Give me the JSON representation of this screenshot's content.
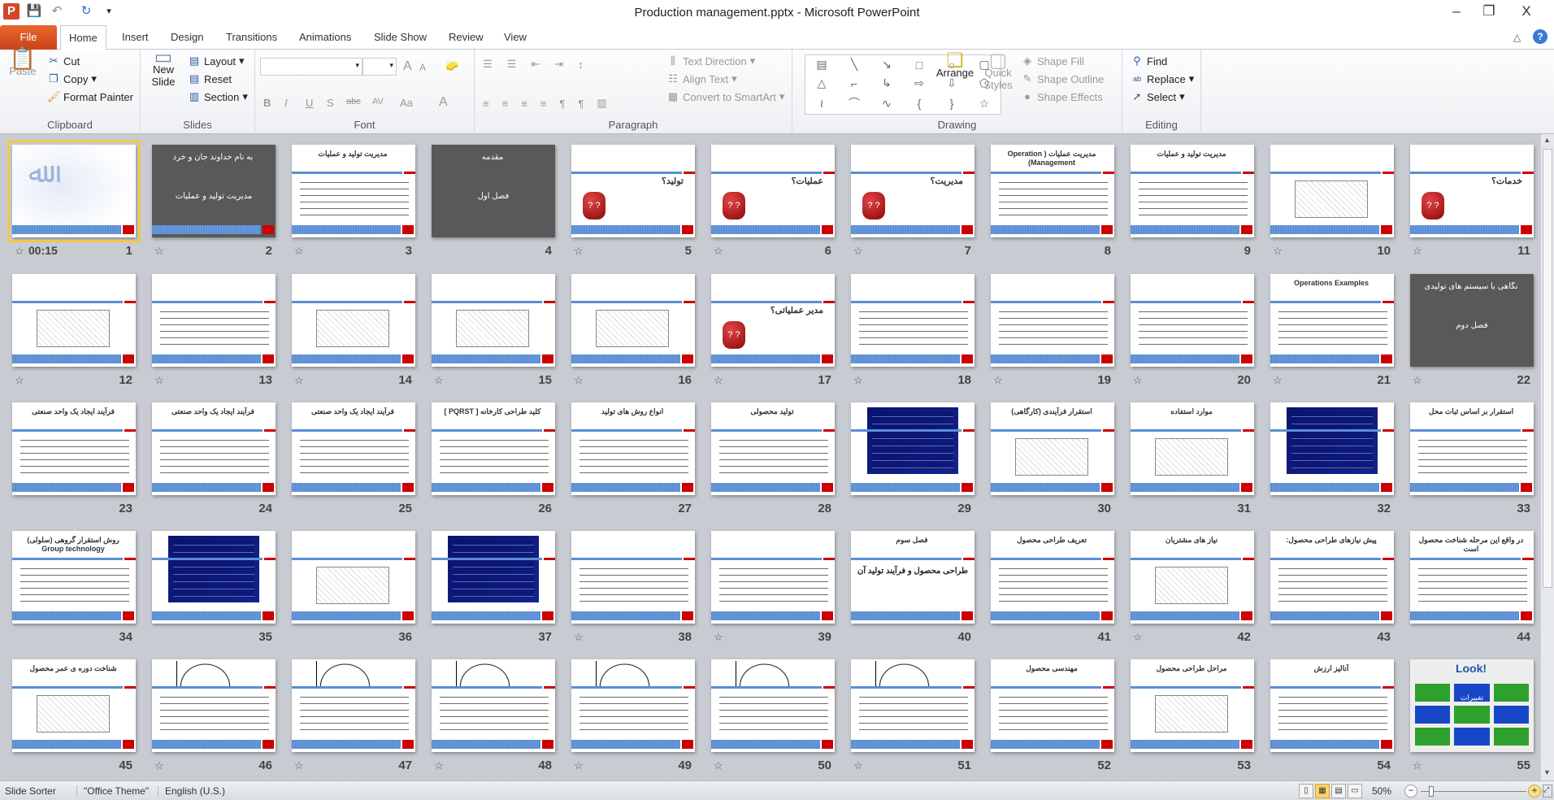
{
  "window": {
    "title": "Production management.pptx - Microsoft PowerPoint",
    "minimize": "–",
    "restore": "❐",
    "close": "X"
  },
  "quick_access": {
    "app_icon": "P",
    "save": "💾",
    "undo": "↶",
    "redo": "↻",
    "customize": "▾"
  },
  "tabs": [
    "File",
    "Home",
    "Insert",
    "Design",
    "Transitions",
    "Animations",
    "Slide Show",
    "Review",
    "View"
  ],
  "ribbon": {
    "clipboard": {
      "label": "Clipboard",
      "paste": "Paste",
      "cut": "Cut",
      "copy": "Copy",
      "format_painter": "Format Painter"
    },
    "slides": {
      "label": "Slides",
      "new_slide": "New Slide",
      "layout": "Layout",
      "reset": "Reset",
      "section": "Section"
    },
    "font": {
      "label": "Font",
      "font_name": "",
      "font_size": "",
      "bold": "B",
      "italic": "I",
      "underline": "U",
      "shadow": "S",
      "strike": "abc",
      "spacing": "AV",
      "case": "Aa",
      "color": "A",
      "grow": "A",
      "shrink": "A"
    },
    "paragraph": {
      "label": "Paragraph",
      "text_direction": "Text Direction",
      "align_text": "Align Text",
      "convert_smartart": "Convert to SmartArt"
    },
    "drawing": {
      "label": "Drawing",
      "arrange": "Arrange",
      "quick_styles": "Quick Styles",
      "shape_fill": "Shape Fill",
      "shape_outline": "Shape Outline",
      "shape_effects": "Shape Effects",
      "shapes": [
        "▤",
        "╲",
        "↘",
        "□",
        "○",
        "▢",
        "△",
        "⌐",
        "↳",
        "⇨",
        "⇩",
        "⬠",
        "≀",
        "⌒",
        "∿",
        "{",
        "}",
        "☆"
      ]
    },
    "editing": {
      "label": "Editing",
      "find": "Find",
      "replace": "Replace",
      "select": "Select"
    }
  },
  "slides": [
    {
      "n": "1",
      "kind": "cal",
      "title": "",
      "star": true,
      "time": "00:15",
      "selected": true
    },
    {
      "n": "2",
      "kind": "dark",
      "title": "به نام خداوند جان و خرد",
      "sub": "مدیریت تولید و عملیات",
      "star": true
    },
    {
      "n": "3",
      "kind": "text",
      "title": "مدیریت تولید و عملیات",
      "star": true
    },
    {
      "n": "4",
      "kind": "dark",
      "title": "مقدمه",
      "sub": "فصل اول",
      "star": false
    },
    {
      "n": "5",
      "kind": "q",
      "title": "تولید؟",
      "star": true
    },
    {
      "n": "6",
      "kind": "q",
      "title": "عملیات؟",
      "star": true
    },
    {
      "n": "7",
      "kind": "q",
      "title": "مدیریت؟",
      "star": true
    },
    {
      "n": "8",
      "kind": "text",
      "title": "مدیریت عملیات ( Operation Management)",
      "star": false
    },
    {
      "n": "9",
      "kind": "text",
      "title": "مدیریت تولید و عملیات",
      "star": false
    },
    {
      "n": "10",
      "kind": "img",
      "title": "",
      "star": true
    },
    {
      "n": "11",
      "kind": "q",
      "title": "خدمات؟",
      "star": true
    },
    {
      "n": "12",
      "kind": "img",
      "title": "",
      "star": true
    },
    {
      "n": "13",
      "kind": "text",
      "title": "",
      "star": true
    },
    {
      "n": "14",
      "kind": "img",
      "title": "",
      "star": true
    },
    {
      "n": "15",
      "kind": "img",
      "title": "",
      "star": true
    },
    {
      "n": "16",
      "kind": "img",
      "title": "",
      "star": true
    },
    {
      "n": "17",
      "kind": "q",
      "title": "مدیر عملیاتی؟",
      "star": true
    },
    {
      "n": "18",
      "kind": "text",
      "title": "",
      "star": true
    },
    {
      "n": "19",
      "kind": "text",
      "title": "",
      "star": true
    },
    {
      "n": "20",
      "kind": "text",
      "title": "",
      "star": true
    },
    {
      "n": "21",
      "kind": "text",
      "title": "Operations   Examples",
      "star": true
    },
    {
      "n": "22",
      "kind": "dark",
      "title": "نگاهی با سیستم های تولیدی",
      "sub": "فصل دوم",
      "star": true
    },
    {
      "n": "23",
      "kind": "text",
      "title": "فرآیند ایجاد یک واحد صنعتی",
      "star": false
    },
    {
      "n": "24",
      "kind": "text",
      "title": "فرآیند ایجاد یک واحد صنعتی",
      "star": false
    },
    {
      "n": "25",
      "kind": "text",
      "title": "فرآیند ایجاد یک واحد صنعتی",
      "star": false
    },
    {
      "n": "26",
      "kind": "text",
      "title": "کلید طراحی کارخانه [ PQRST ]",
      "star": false
    },
    {
      "n": "27",
      "kind": "text",
      "title": "انواع روش های تولید",
      "star": false
    },
    {
      "n": "28",
      "kind": "text",
      "title": "تولید محصولی",
      "star": false
    },
    {
      "n": "29",
      "kind": "navy",
      "title": "",
      "star": false
    },
    {
      "n": "30",
      "kind": "img",
      "title": "استقرار فرآیندی (کارگاهی)",
      "star": false
    },
    {
      "n": "31",
      "kind": "img",
      "title": "موارد استفاده",
      "star": false
    },
    {
      "n": "32",
      "kind": "navy",
      "title": "",
      "star": false
    },
    {
      "n": "33",
      "kind": "text",
      "title": "استقرار بر اساس ثبات محل",
      "star": false
    },
    {
      "n": "34",
      "kind": "text",
      "title": "روش استقرار گروهی (سلولی) Group technology",
      "star": false
    },
    {
      "n": "35",
      "kind": "navy",
      "title": "",
      "star": false
    },
    {
      "n": "36",
      "kind": "img",
      "title": "",
      "star": false
    },
    {
      "n": "37",
      "kind": "navy",
      "title": "",
      "star": false
    },
    {
      "n": "38",
      "kind": "text",
      "title": "",
      "star": true
    },
    {
      "n": "39",
      "kind": "text",
      "title": "",
      "star": true
    },
    {
      "n": "40",
      "kind": "text",
      "title": "فصل سوم",
      "sub": "طراحی محصول و فرآیند تولید آن",
      "star": false
    },
    {
      "n": "41",
      "kind": "text",
      "title": "تعریف طراحی محصول",
      "star": false
    },
    {
      "n": "42",
      "kind": "img",
      "title": "نیاز های مشتریان",
      "star": true
    },
    {
      "n": "43",
      "kind": "text",
      "title": "پیش نیازهای طراحی محصول:",
      "star": false
    },
    {
      "n": "44",
      "kind": "text",
      "title": "در واقع این مرحله شناخت محصول است",
      "star": false
    },
    {
      "n": "45",
      "kind": "img",
      "title": "شناخت دوره ی عمر محصول",
      "star": false
    },
    {
      "n": "46",
      "kind": "curve",
      "title": "",
      "star": true
    },
    {
      "n": "47",
      "kind": "curve",
      "title": "",
      "star": true
    },
    {
      "n": "48",
      "kind": "curve",
      "title": "",
      "star": true
    },
    {
      "n": "49",
      "kind": "curve",
      "title": "",
      "star": true
    },
    {
      "n": "50",
      "kind": "curve",
      "title": "",
      "star": true
    },
    {
      "n": "51",
      "kind": "curve",
      "title": "",
      "star": true
    },
    {
      "n": "52",
      "kind": "text",
      "title": "مهندسی محصول",
      "star": false
    },
    {
      "n": "53",
      "kind": "img",
      "title": "مراحل طراحی محصول",
      "star": false
    },
    {
      "n": "54",
      "kind": "text",
      "title": "آنالیز ارزش",
      "star": false
    },
    {
      "n": "55",
      "kind": "look",
      "title": "Look!",
      "sub": "تغییرات",
      "star": true
    }
  ],
  "status": {
    "view": "Slide Sorter",
    "theme": "\"Office Theme\"",
    "language": "English (U.S.)",
    "zoom": "50%",
    "zoom_percent": 50
  },
  "colors": {
    "file_tab": "#d4521f",
    "accent_blue": "#5a8fd4",
    "accent_red": "#c00000",
    "selection": "#f3c64c"
  }
}
